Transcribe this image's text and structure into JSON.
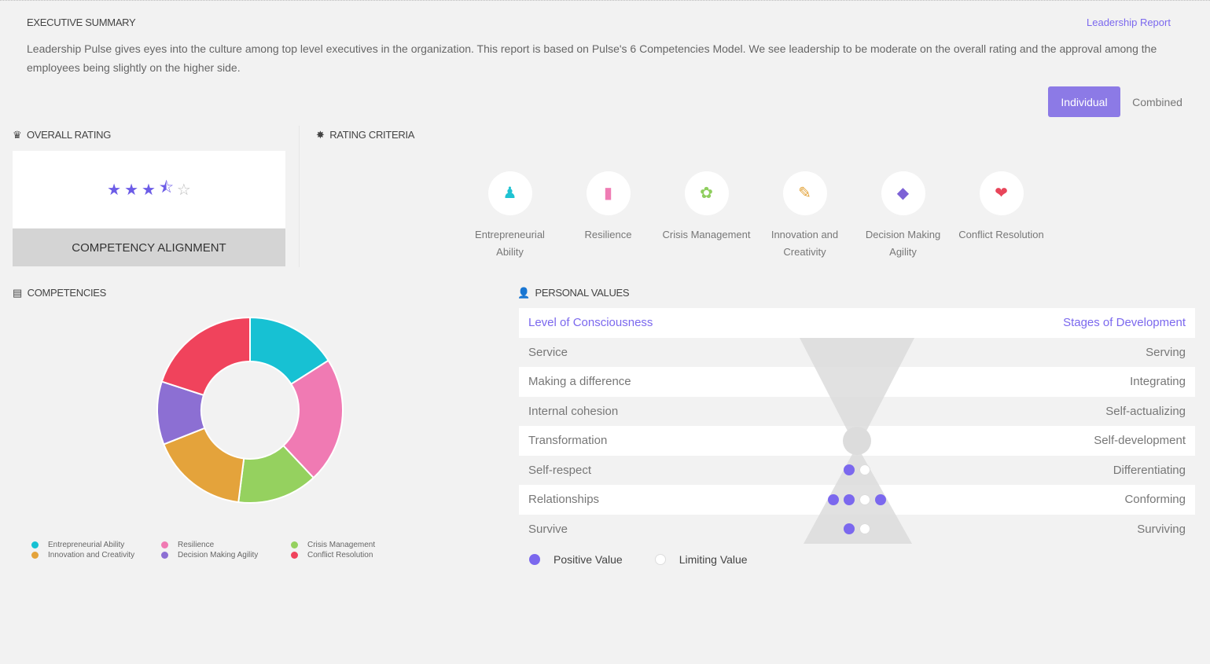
{
  "header": {
    "title": "EXECUTIVE SUMMARY",
    "report_link": "Leadership Report",
    "summary": "Leadership Pulse gives eyes into the culture among top level executives in the organization. This report is based on Pulse's 6 Competencies Model. We see leadership to be moderate on the overall rating and the approval among the employees being slightly on the higher side."
  },
  "toggle": {
    "individual": "Individual",
    "combined": "Combined"
  },
  "overall": {
    "title": "OVERALL RATING",
    "rating": 3.5,
    "max": 5,
    "stars": [
      "★",
      "★",
      "★",
      "⯪",
      "☆"
    ],
    "alignment_label": "COMPETENCY ALIGNMENT"
  },
  "criteria": {
    "title": "RATING CRITERIA",
    "items": [
      {
        "label": "Entrepreneurial Ability",
        "icon": "person-icon",
        "glyph": "♟",
        "color": "#1fc3d2"
      },
      {
        "label": "Resilience",
        "icon": "battery-icon",
        "glyph": "▮",
        "color": "#ef7cb4"
      },
      {
        "label": "Crisis Management",
        "icon": "gear-icon",
        "glyph": "✿",
        "color": "#8fce5e"
      },
      {
        "label": "Innovation and Creativity",
        "icon": "pencil-icon",
        "glyph": "✎",
        "color": "#e3a33a"
      },
      {
        "label": "Decision Making Agility",
        "icon": "diamond-icon",
        "glyph": "◆",
        "color": "#7d62d6"
      },
      {
        "label": "Conflict Resolution",
        "icon": "handshake-icon",
        "glyph": "❤",
        "color": "#e8455a"
      }
    ]
  },
  "competencies": {
    "title": "COMPETENCIES"
  },
  "chart_data": {
    "type": "pie",
    "donut": true,
    "categories": [
      "Entrepreneurial Ability",
      "Resilience",
      "Crisis Management",
      "Innovation and Creativity",
      "Decision Making Agility",
      "Conflict Resolution"
    ],
    "values": [
      16,
      22,
      14,
      17,
      11,
      20
    ],
    "colors": [
      "#17c1d3",
      "#f07ab3",
      "#95d15f",
      "#e4a33b",
      "#8c6fd3",
      "#f0435c"
    ],
    "legend": "bottom"
  },
  "personal_values": {
    "title": "PERSONAL VALUES",
    "header_left": "Level of Consciousness",
    "header_right": "Stages of Development",
    "rows": [
      {
        "left": "Service",
        "right": "Serving",
        "dots": []
      },
      {
        "left": "Making a difference",
        "right": "Integrating",
        "dots": []
      },
      {
        "left": "Internal cohesion",
        "right": "Self-actualizing",
        "dots": []
      },
      {
        "left": "Transformation",
        "right": "Self-development",
        "dots": []
      },
      {
        "left": "Self-respect",
        "right": "Differentiating",
        "dots": [
          "p",
          "l"
        ]
      },
      {
        "left": "Relationships",
        "right": "Conforming",
        "dots": [
          "p",
          "p",
          "l",
          "p"
        ]
      },
      {
        "left": "Survive",
        "right": "Surviving",
        "dots": [
          "p",
          "l"
        ]
      }
    ],
    "legend_positive": "Positive Value",
    "legend_limiting": "Limiting Value"
  }
}
